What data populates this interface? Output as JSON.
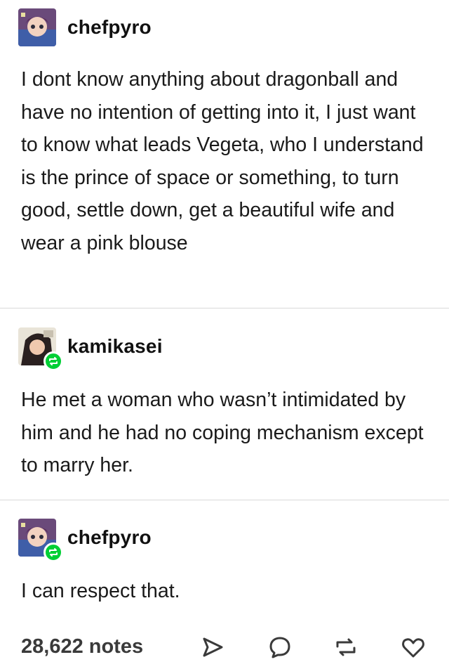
{
  "posts": [
    {
      "username": "chefpyro",
      "body": "I dont know anything about dragonball and have no intention of getting into it, I just want to know what leads Vegeta, who I understand is the prince of space or something, to turn good, settle down, get a beautiful wife and wear a pink blouse"
    },
    {
      "username": "kamikasei",
      "body": "He met a woman who wasn’t intimidated by him and he had no coping mechanism except to marry her."
    },
    {
      "username": "chefpyro",
      "body": "I can respect that."
    }
  ],
  "footer": {
    "notes": "28,622 notes"
  },
  "icons": {
    "share": "share-icon",
    "reply": "reply-icon",
    "reblog": "reblog-icon",
    "like": "heart-icon"
  },
  "colors": {
    "reblog_badge": "#00cf35",
    "divider": "#d9d9d9"
  }
}
